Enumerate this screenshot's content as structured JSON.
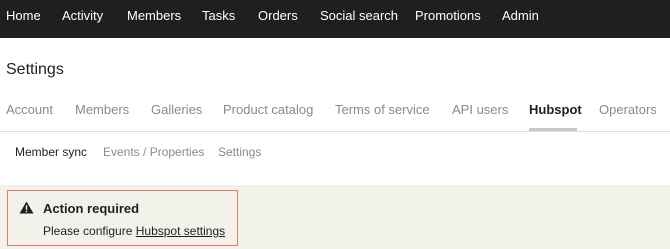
{
  "topnav": {
    "items": [
      "Home",
      "Activity",
      "Members",
      "Tasks",
      "Orders",
      "Social search",
      "Promotions",
      "Admin"
    ]
  },
  "page": {
    "title": "Settings"
  },
  "tabs": {
    "items": [
      "Account",
      "Members",
      "Galleries",
      "Product catalog",
      "Terms of service",
      "API users",
      "Hubspot",
      "Operators"
    ],
    "active": "Hubspot"
  },
  "subtabs": {
    "items": [
      "Member sync",
      "Events / Properties",
      "Settings"
    ],
    "active": "Member sync"
  },
  "alert": {
    "icon": "warning-icon",
    "title": "Action required",
    "text_prefix": "Please configure ",
    "link_text": "Hubspot settings",
    "border_color": "#e07c62",
    "background_color": "#f3f2ea"
  },
  "colors": {
    "nav_background": "#1f1f1f",
    "tab_inactive": "#8a8a8a"
  }
}
